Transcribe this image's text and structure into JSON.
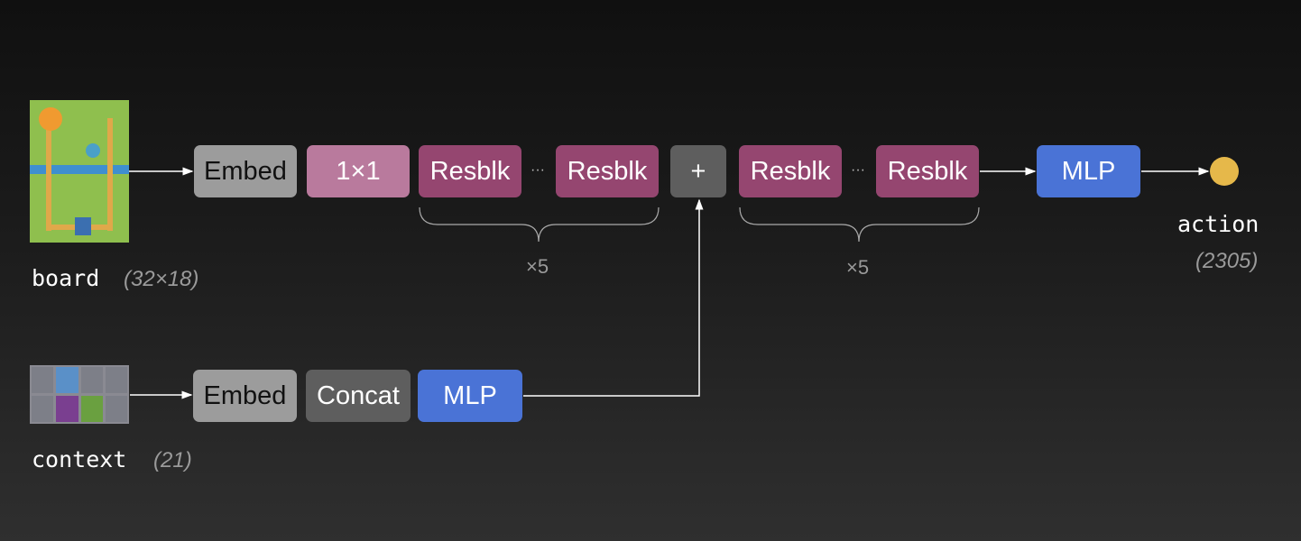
{
  "board": {
    "label": "board",
    "dims": "(32×18)"
  },
  "context": {
    "label": "context",
    "dims": "(21)"
  },
  "action": {
    "label": "action",
    "dims": "(2305)"
  },
  "top_row": {
    "embed": "Embed",
    "conv": "1×1",
    "resblk_a": "Resblk",
    "ellipsis_a": "···",
    "resblk_b": "Resblk",
    "add": "+",
    "resblk_c": "Resblk",
    "ellipsis_b": "···",
    "resblk_d": "Resblk",
    "mlp": "MLP",
    "repeat_a": "×5",
    "repeat_b": "×5"
  },
  "bottom_row": {
    "embed": "Embed",
    "concat": "Concat",
    "mlp": "MLP"
  },
  "colors": {
    "embed": "#9c9c9c",
    "conv": "#b97a9d",
    "resblk": "#954670",
    "add": "#5e5e5e",
    "concat": "#5e5e5e",
    "mlp": "#4a73d6",
    "action_node": "#e6b84a"
  }
}
